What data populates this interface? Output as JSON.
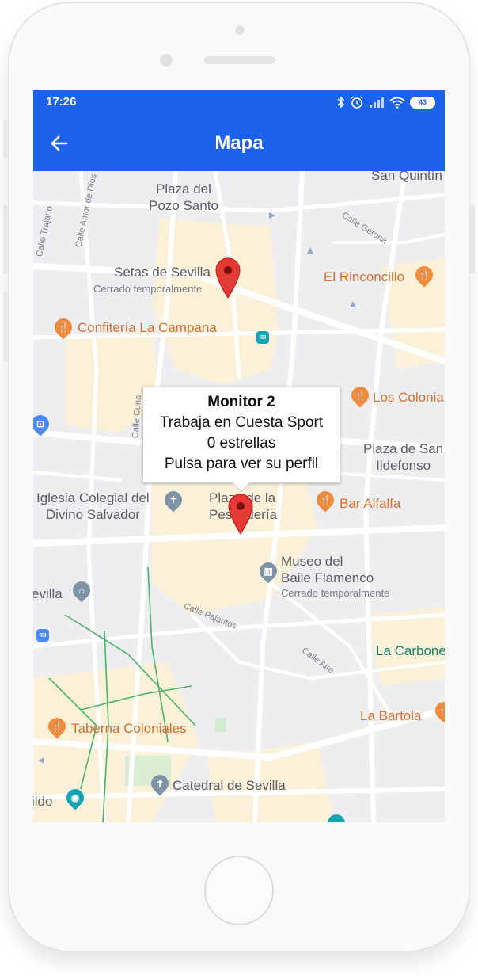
{
  "status_bar": {
    "time": "17:26",
    "battery": "43"
  },
  "app_bar": {
    "title": "Mapa"
  },
  "map": {
    "labels": {
      "plaza_pozo_santo": "Plaza del\nPozo Santo",
      "san_quintin": "San Quintín",
      "setas": "Setas de Sevilla",
      "setas_status": "Cerrado temporalmente",
      "rinconcillo": "El Rinconcillo",
      "campana": "Confitería La Campana",
      "colonia": "Los Colonia",
      "plaza_san_ildefonso": "Plaza de San\nIldefonso",
      "iglesia": "Iglesia Colegial del\nDivino Salvador",
      "plaza_pescaderia": "Plaza de la\nPescadería",
      "bar_alfalfa": "Bar Alfalfa",
      "museo": "Museo del\nBaile Flamenco",
      "museo_status": "Cerrado temporalmente",
      "sevilla_left": "evilla",
      "la_carbonería": "La Carbone",
      "la_bartola": "La Bartola",
      "taberna": "Taberna Coloniales",
      "catedral": "Catedral de Sevilla",
      "cabildo": "ildo",
      "calle_trajano": "Calle Trajano",
      "calle_amor_dios": "Calle Amor de Dios",
      "calle_gerona": "Calle Gerona",
      "calle_cuna": "Calle Cuna",
      "calle_pajaritos": "Calle Pajaritos",
      "calle_aire": "Calle Aire"
    },
    "info_window": {
      "title": "Monitor 2",
      "line1": "Trabaja en Cuesta Sport",
      "line2": "0 estrellas",
      "line3": "Pulsa para ver su perfil"
    }
  },
  "colors": {
    "brand": "#1d63ea",
    "marker": "#e53935",
    "poi_food": "#f08b3b"
  }
}
